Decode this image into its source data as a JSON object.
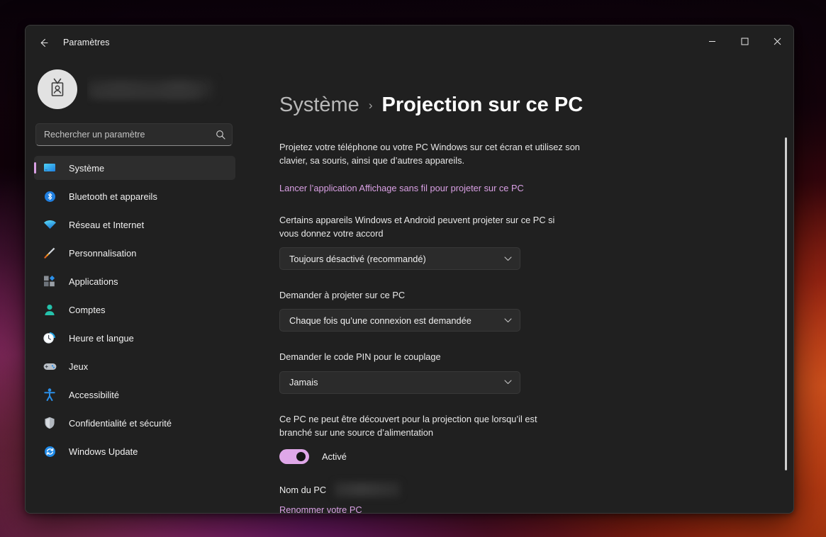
{
  "window": {
    "title": "Paramètres",
    "back_label": "back-arrow",
    "minimize_label": "Réduire",
    "maximize_label": "Agrandir",
    "close_label": "Fermer"
  },
  "sidebar": {
    "profile": {
      "name": "",
      "avatar_icon": "id-badge-icon"
    },
    "search": {
      "placeholder": "Rechercher un paramètre",
      "value": "",
      "icon": "search-icon"
    },
    "items": [
      {
        "label": "Système",
        "icon": "monitor-icon",
        "active": true
      },
      {
        "label": "Bluetooth et appareils",
        "icon": "bluetooth-icon",
        "active": false
      },
      {
        "label": "Réseau et Internet",
        "icon": "wifi-icon",
        "active": false
      },
      {
        "label": "Personnalisation",
        "icon": "paintbrush-icon",
        "active": false
      },
      {
        "label": "Applications",
        "icon": "apps-icon",
        "active": false
      },
      {
        "label": "Comptes",
        "icon": "person-icon",
        "active": false
      },
      {
        "label": "Heure et langue",
        "icon": "clock-icon",
        "active": false
      },
      {
        "label": "Jeux",
        "icon": "gamepad-icon",
        "active": false
      },
      {
        "label": "Accessibilité",
        "icon": "accessibility-icon",
        "active": false
      },
      {
        "label": "Confidentialité et sécurité",
        "icon": "shield-icon",
        "active": false
      },
      {
        "label": "Windows Update",
        "icon": "update-icon",
        "active": false
      }
    ]
  },
  "main": {
    "breadcrumb": {
      "parent": "Système",
      "separator": "›",
      "current": "Projection sur ce PC"
    },
    "description": "Projetez votre téléphone ou votre PC Windows sur cet écran et utilisez son clavier, sa souris, ainsi que d’autres appareils.",
    "launch_link": "Lancer l’application Affichage sans fil pour projeter sur ce PC",
    "settings": [
      {
        "label": "Certains appareils Windows et Android peuvent projeter sur ce PC si vous donnez votre accord",
        "value": "Toujours désactivé (recommandé)"
      },
      {
        "label": "Demander à projeter sur ce PC",
        "value": "Chaque fois qu’une connexion est demandée"
      },
      {
        "label": "Demander le code PIN pour le couplage",
        "value": "Jamais"
      }
    ],
    "power_setting": {
      "label": "Ce PC ne peut être découvert pour la projection que lorsqu’il est branché sur une source d’alimentation",
      "toggle_state": "Activé"
    },
    "pc_name": {
      "label": "Nom du PC",
      "value": "",
      "rename_link": "Renommer votre PC"
    }
  },
  "colors": {
    "accent": "#d9a0e4",
    "window_bg": "#202020",
    "control_bg": "#2b2b2b",
    "toggle_on": "#dfa7e8"
  }
}
